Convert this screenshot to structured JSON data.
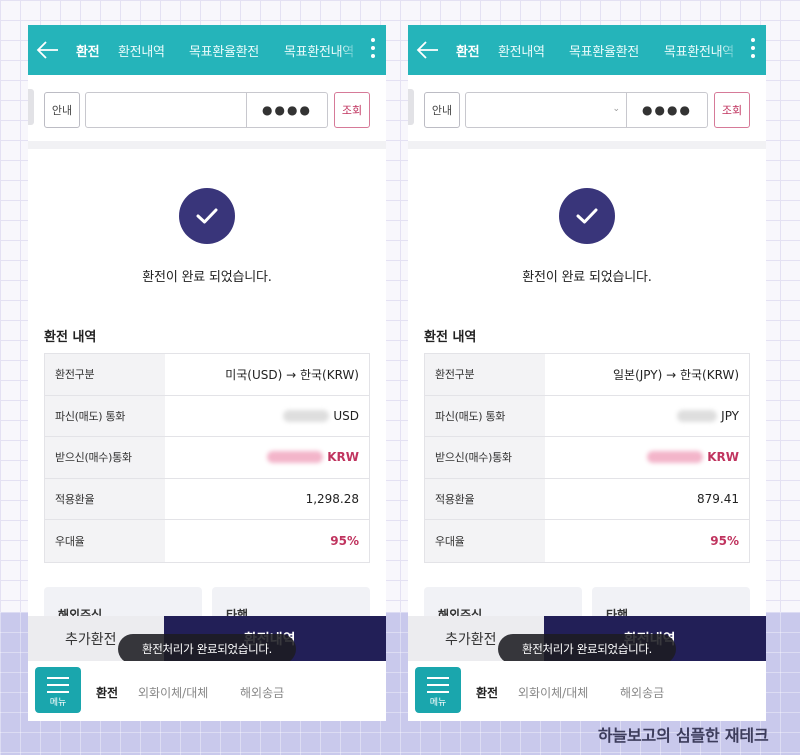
{
  "topbar": {
    "tabs": [
      "환전",
      "환전내역",
      "목표환율환전",
      "목표환전내역"
    ],
    "bg_color": "#25b4ba",
    "back_icon": "arrow-left-icon",
    "more_icon": "vertical-dots-icon"
  },
  "account_bar": {
    "guide_label": "안내",
    "password_mask": "●●●●",
    "query_label": "조회"
  },
  "result": {
    "check_icon": "check-circle-icon",
    "message": "환전이 완료 되었습니다.",
    "section_title": "환전 내역"
  },
  "labels": {
    "type": "환전구분",
    "sell": "파신(매도) 통화",
    "buy": "받으신(매수)통화",
    "rate": "적용환율",
    "discount": "우대율"
  },
  "screens": [
    {
      "direction": "미국(USD) → 한국(KRW)",
      "sell_currency": "USD",
      "buy_currency": "KRW",
      "rate": "1,298.28",
      "discount": "95%"
    },
    {
      "direction": "일본(JPY) → 한국(KRW)",
      "sell_currency": "JPY",
      "buy_currency": "KRW",
      "rate": "879.41",
      "discount": "95%"
    }
  ],
  "cards": [
    "해외주식",
    "타행"
  ],
  "actions": {
    "add_label": "추가환전",
    "history_label": "환전내역"
  },
  "toast": "환전처리가 완료되었습니다.",
  "bottom_nav": {
    "menu_label": "메뉴",
    "items": [
      "환전",
      "외화이체/대체",
      "해외송금"
    ]
  },
  "watermark": "하늘보고의 심플한 재테크",
  "colors": {
    "accent": "#c0345f",
    "navy": "#221f57",
    "check": "#39357a",
    "teal": "#1aa6ad"
  }
}
